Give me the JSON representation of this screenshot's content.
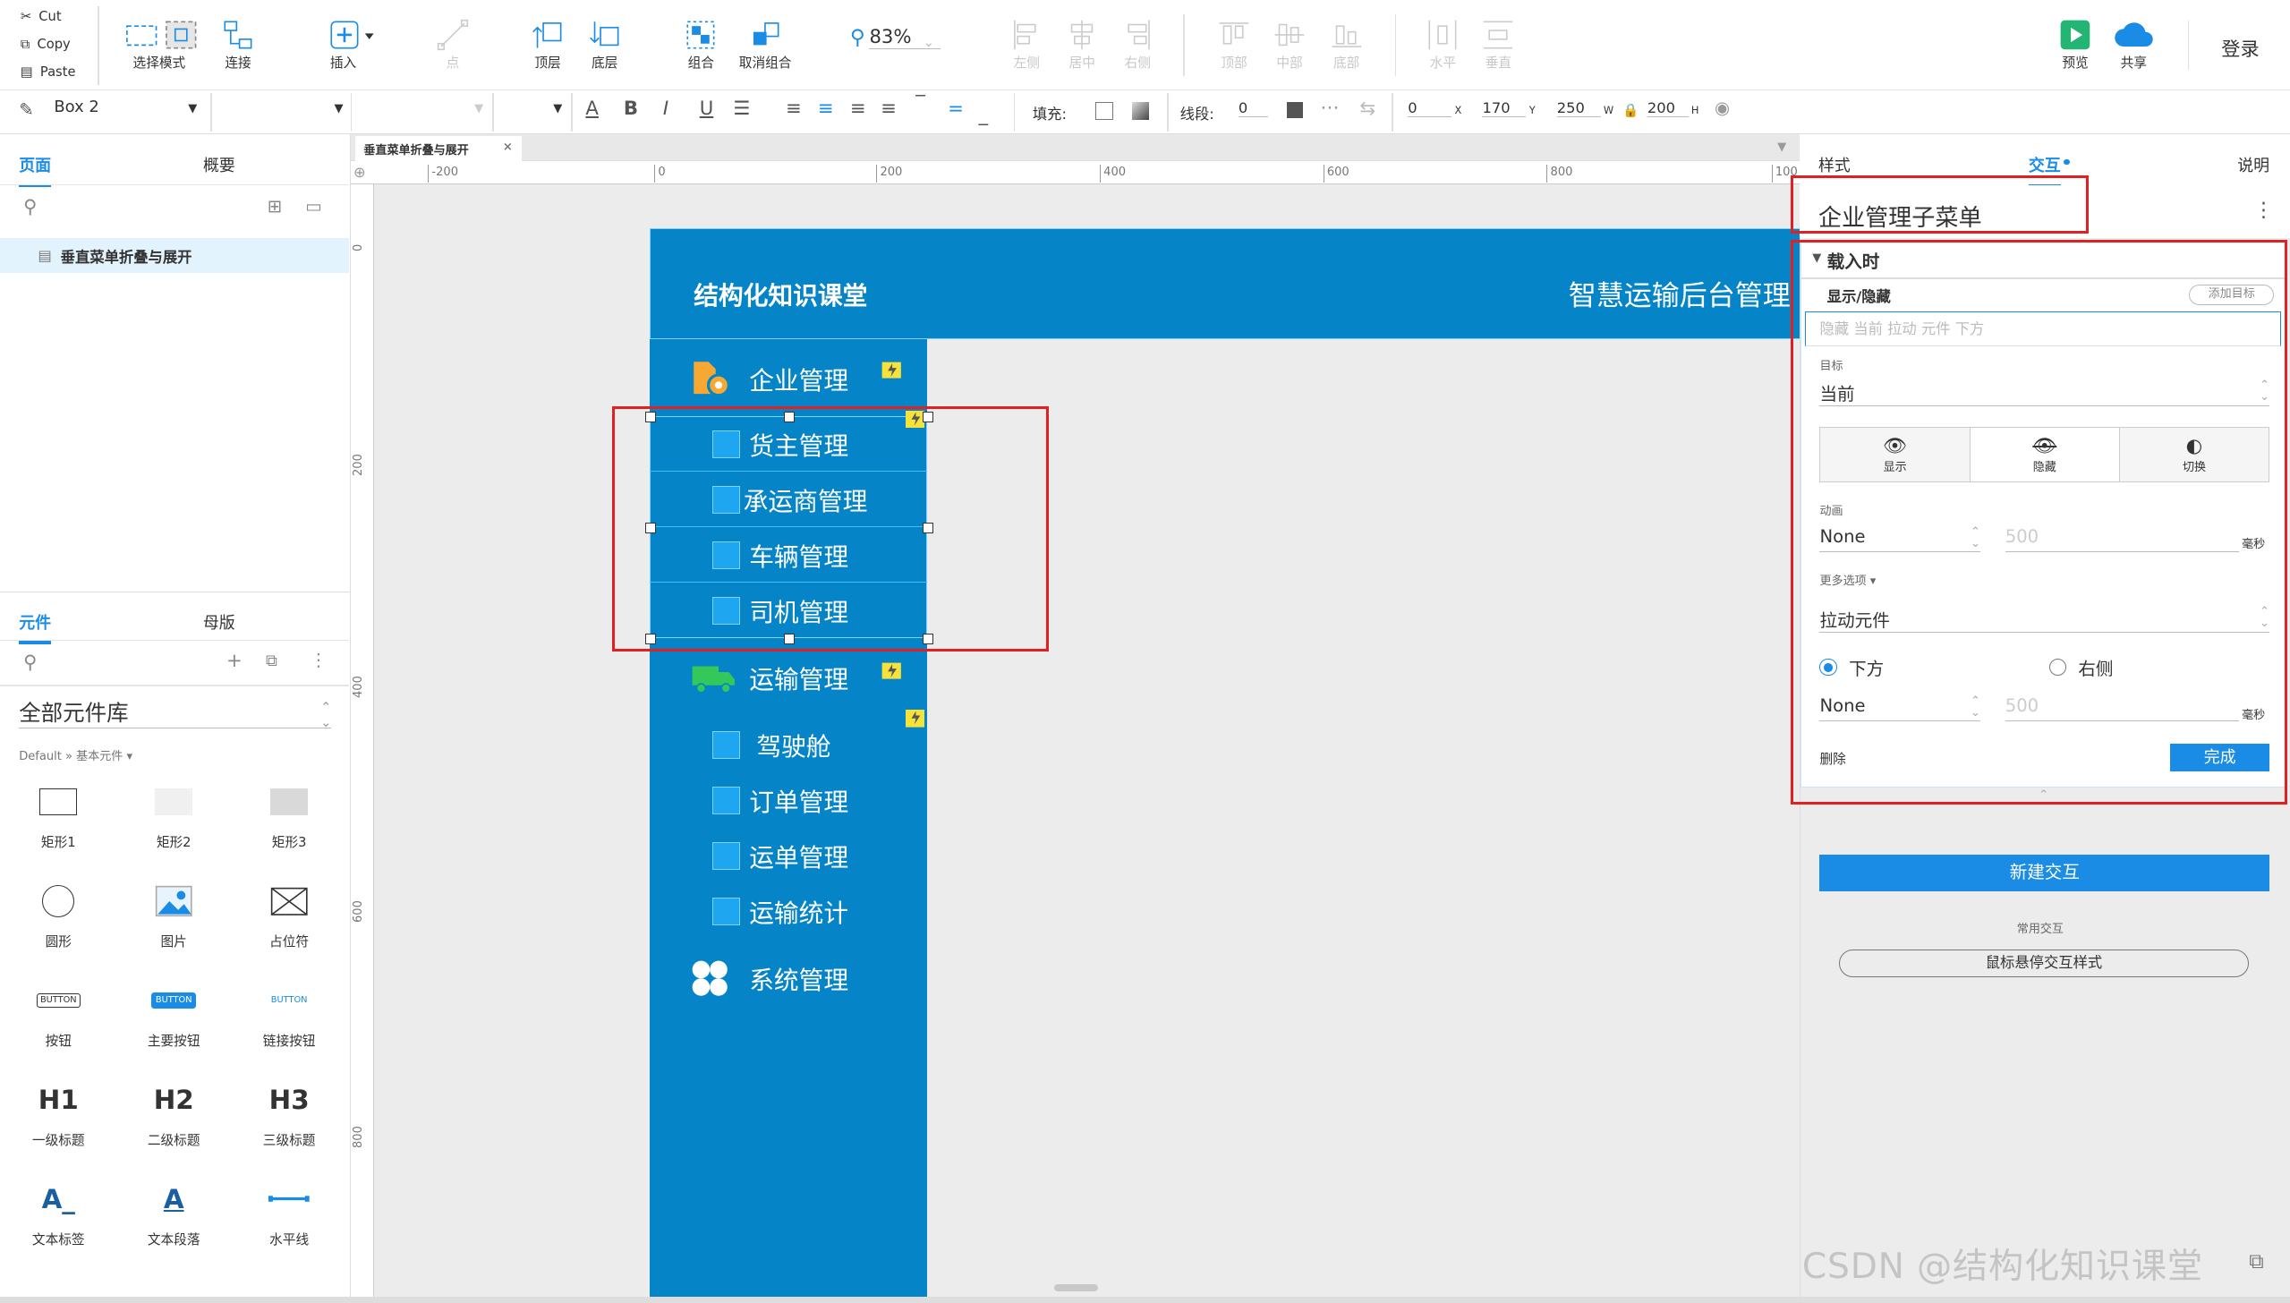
{
  "clipboard": {
    "cut": "Cut",
    "copy": "Copy",
    "paste": "Paste"
  },
  "toolbar": {
    "select_mode": "选择模式",
    "connect": "连接",
    "insert": "插入",
    "point": "点",
    "bring_front": "顶层",
    "send_back": "底层",
    "group": "组合",
    "ungroup": "取消组合",
    "zoom": "83%",
    "align_left": "左侧",
    "align_center": "居中",
    "align_right": "右侧",
    "align_top": "顶部",
    "align_middle": "中部",
    "align_bottom": "底部",
    "dist_h": "水平",
    "dist_v": "垂直",
    "preview": "预览",
    "share": "共享",
    "login": "登录"
  },
  "format_bar": {
    "widget_name": "Box 2",
    "fill_label": "填充:",
    "stroke_label": "线段:",
    "stroke_value": "0",
    "x": "0",
    "x_label": "X",
    "y": "170",
    "y_label": "Y",
    "w": "250",
    "w_label": "W",
    "h": "200",
    "h_label": "H",
    "bold": "B",
    "italic": "I",
    "underline": "U",
    "font_color": "A"
  },
  "pages_panel": {
    "tab_pages": "页面",
    "tab_outline": "概要",
    "page_item": "垂直菜单折叠与展开"
  },
  "library_panel": {
    "tab_widgets": "元件",
    "tab_masters": "母版",
    "library": "全部元件库",
    "breadcrumb": "Default » 基本元件 ▾",
    "widgets": [
      {
        "label": "矩形1",
        "icon": "rect-outline"
      },
      {
        "label": "矩形2",
        "icon": "rect-light"
      },
      {
        "label": "矩形3",
        "icon": "rect-grey"
      },
      {
        "label": "圆形",
        "icon": "circle"
      },
      {
        "label": "图片",
        "icon": "image"
      },
      {
        "label": "占位符",
        "icon": "placeholder"
      },
      {
        "label": "按钮",
        "icon": "button",
        "text": "BUTTON"
      },
      {
        "label": "主要按钮",
        "icon": "primary-button",
        "text": "BUTTON"
      },
      {
        "label": "链接按钮",
        "icon": "link-button",
        "text": "BUTTON"
      },
      {
        "label": "一级标题",
        "icon": "h1",
        "text": "H1"
      },
      {
        "label": "二级标题",
        "icon": "h2",
        "text": "H2"
      },
      {
        "label": "三级标题",
        "icon": "h3",
        "text": "H3"
      },
      {
        "label": "文本标签",
        "icon": "text-label",
        "text": "A_"
      },
      {
        "label": "文本段落",
        "icon": "text-paragraph",
        "text": "A"
      },
      {
        "label": "水平线",
        "icon": "horizontal-line"
      }
    ]
  },
  "canvas": {
    "tab": "垂直菜单折叠与展开",
    "ruler_h": [
      "-200",
      "0",
      "200",
      "400",
      "600",
      "800",
      "100"
    ],
    "ruler_v": [
      "0",
      "200",
      "400",
      "600",
      "800"
    ],
    "header_left": "结构化知识课堂",
    "header_right": "智慧运输后台管理",
    "menu": {
      "group1": "企业管理",
      "group1_items": [
        "货主管理",
        "承运商管理",
        "车辆管理",
        "司机管理"
      ],
      "group2": "运输管理",
      "group2_items": [
        "驾驶舱",
        "订单管理",
        "运单管理",
        "运输统计"
      ],
      "group3": "系统管理"
    }
  },
  "right_panel": {
    "tab_style": "样式",
    "tab_interaction": "交互",
    "tab_notes": "说明",
    "widget_title": "企业管理子菜单",
    "event": "载入时",
    "action": "显示/隐藏",
    "add_target": "添加目标",
    "summary": "隐藏 当前 拉动 元件 下方",
    "target_label": "目标",
    "target_value": "当前",
    "vis_show": "显示",
    "vis_hide": "隐藏",
    "vis_toggle": "切换",
    "anim_label": "动画",
    "anim_value": "None",
    "anim_ms": "500",
    "ms_unit": "毫秒",
    "more_options": "更多选项 ▾",
    "push_value": "拉动元件",
    "radio_below": "下方",
    "radio_right": "右侧",
    "anim2_value": "None",
    "anim2_ms": "500",
    "delete": "删除",
    "done": "完成",
    "new_interaction": "新建交互",
    "common_label": "常用交互",
    "hover_style": "鼠标悬停交互样式"
  },
  "watermark": "CSDN @结构化知识课堂",
  "colors": {
    "menu_bg": "#0585c8",
    "accent": "#1a8ce6",
    "highlight": "#e12121"
  }
}
